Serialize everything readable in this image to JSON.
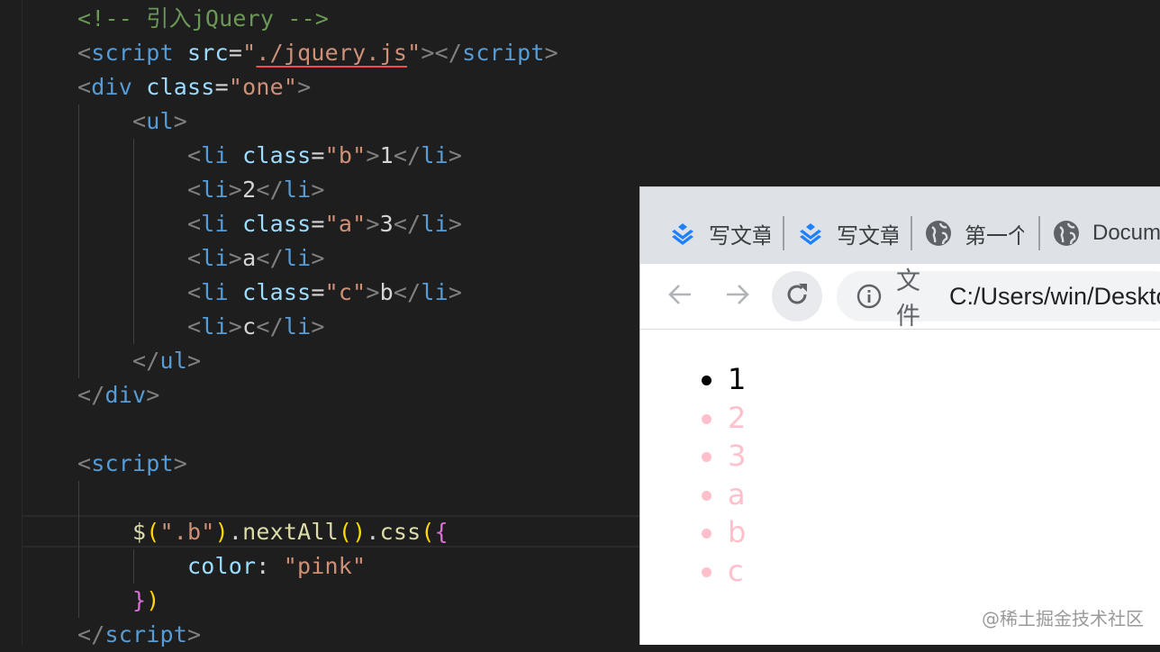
{
  "editor": {
    "lines": [
      [
        [
          "tk-cmt",
          "<!-- 引入jQuery -->"
        ]
      ],
      [
        [
          "tk-punct",
          "<"
        ],
        [
          "tk-tag",
          "script"
        ],
        [
          "tk-text",
          " "
        ],
        [
          "tk-attr",
          "src"
        ],
        [
          "tk-text",
          "="
        ],
        [
          "tk-str",
          "\""
        ],
        [
          "tk-str src-link",
          "./jquery.js"
        ],
        [
          "tk-str",
          "\""
        ],
        [
          "tk-punct",
          "></"
        ],
        [
          "tk-tag",
          "script"
        ],
        [
          "tk-punct",
          ">"
        ]
      ],
      [
        [
          "tk-punct",
          "<"
        ],
        [
          "tk-tag",
          "div"
        ],
        [
          "tk-text",
          " "
        ],
        [
          "tk-attr",
          "class"
        ],
        [
          "tk-text",
          "="
        ],
        [
          "tk-str",
          "\"one\""
        ],
        [
          "tk-punct",
          ">"
        ]
      ],
      [
        [
          "tk-text",
          "    "
        ],
        [
          "tk-punct",
          "<"
        ],
        [
          "tk-tag",
          "ul"
        ],
        [
          "tk-punct",
          ">"
        ]
      ],
      [
        [
          "tk-text",
          "        "
        ],
        [
          "tk-punct",
          "<"
        ],
        [
          "tk-tag",
          "li"
        ],
        [
          "tk-text",
          " "
        ],
        [
          "tk-attr",
          "class"
        ],
        [
          "tk-text",
          "="
        ],
        [
          "tk-str",
          "\"b\""
        ],
        [
          "tk-punct",
          ">"
        ],
        [
          "tk-text",
          "1"
        ],
        [
          "tk-punct",
          "</"
        ],
        [
          "tk-tag",
          "li"
        ],
        [
          "tk-punct",
          ">"
        ]
      ],
      [
        [
          "tk-text",
          "        "
        ],
        [
          "tk-punct",
          "<"
        ],
        [
          "tk-tag",
          "li"
        ],
        [
          "tk-punct",
          ">"
        ],
        [
          "tk-text",
          "2"
        ],
        [
          "tk-punct",
          "</"
        ],
        [
          "tk-tag",
          "li"
        ],
        [
          "tk-punct",
          ">"
        ]
      ],
      [
        [
          "tk-text",
          "        "
        ],
        [
          "tk-punct",
          "<"
        ],
        [
          "tk-tag",
          "li"
        ],
        [
          "tk-text",
          " "
        ],
        [
          "tk-attr",
          "class"
        ],
        [
          "tk-text",
          "="
        ],
        [
          "tk-str",
          "\"a\""
        ],
        [
          "tk-punct",
          ">"
        ],
        [
          "tk-text",
          "3"
        ],
        [
          "tk-punct",
          "</"
        ],
        [
          "tk-tag",
          "li"
        ],
        [
          "tk-punct",
          ">"
        ]
      ],
      [
        [
          "tk-text",
          "        "
        ],
        [
          "tk-punct",
          "<"
        ],
        [
          "tk-tag",
          "li"
        ],
        [
          "tk-punct",
          ">"
        ],
        [
          "tk-text",
          "a"
        ],
        [
          "tk-punct",
          "</"
        ],
        [
          "tk-tag",
          "li"
        ],
        [
          "tk-punct",
          ">"
        ]
      ],
      [
        [
          "tk-text",
          "        "
        ],
        [
          "tk-punct",
          "<"
        ],
        [
          "tk-tag",
          "li"
        ],
        [
          "tk-text",
          " "
        ],
        [
          "tk-attr",
          "class"
        ],
        [
          "tk-text",
          "="
        ],
        [
          "tk-str",
          "\"c\""
        ],
        [
          "tk-punct",
          ">"
        ],
        [
          "tk-text",
          "b"
        ],
        [
          "tk-punct",
          "</"
        ],
        [
          "tk-tag",
          "li"
        ],
        [
          "tk-punct",
          ">"
        ]
      ],
      [
        [
          "tk-text",
          "        "
        ],
        [
          "tk-punct",
          "<"
        ],
        [
          "tk-tag",
          "li"
        ],
        [
          "tk-punct",
          ">"
        ],
        [
          "tk-text",
          "c"
        ],
        [
          "tk-punct",
          "</"
        ],
        [
          "tk-tag",
          "li"
        ],
        [
          "tk-punct",
          ">"
        ]
      ],
      [
        [
          "tk-text",
          "    "
        ],
        [
          "tk-punct",
          "</"
        ],
        [
          "tk-tag",
          "ul"
        ],
        [
          "tk-punct",
          ">"
        ]
      ],
      [
        [
          "tk-punct",
          "</"
        ],
        [
          "tk-tag",
          "div"
        ],
        [
          "tk-punct",
          ">"
        ]
      ],
      [],
      [
        [
          "tk-punct",
          "<"
        ],
        [
          "tk-tag",
          "script"
        ],
        [
          "tk-punct",
          ">"
        ]
      ],
      [],
      [
        [
          "tk-text",
          "    "
        ],
        [
          "tk-fn",
          "$"
        ],
        [
          "tk-br1",
          "("
        ],
        [
          "tk-str",
          "\".b\""
        ],
        [
          "tk-br1",
          ")"
        ],
        [
          "tk-text",
          "."
        ],
        [
          "tk-fn",
          "nextAll"
        ],
        [
          "tk-br1",
          "()"
        ],
        [
          "tk-text",
          "."
        ],
        [
          "tk-fn",
          "css"
        ],
        [
          "tk-br1",
          "("
        ],
        [
          "tk-br2",
          "{"
        ]
      ],
      [
        [
          "tk-text",
          "        "
        ],
        [
          "tk-attr",
          "color"
        ],
        [
          "tk-text",
          ": "
        ],
        [
          "tk-str",
          "\"pink\""
        ]
      ],
      [
        [
          "tk-text",
          "    "
        ],
        [
          "tk-br2",
          "}"
        ],
        [
          "tk-br1",
          ")"
        ]
      ],
      [
        [
          "tk-punct",
          "</"
        ],
        [
          "tk-tag",
          "script"
        ],
        [
          "tk-punct",
          ">"
        ]
      ]
    ]
  },
  "browser": {
    "tabs": [
      {
        "label": "写文章",
        "icon": "juejin-logo-icon"
      },
      {
        "label": "写文章",
        "icon": "juejin-logo-icon"
      },
      {
        "label": "第一个",
        "icon": "globe-icon"
      },
      {
        "label": "Document",
        "icon": "globe-icon"
      }
    ],
    "nav": {
      "back": "arrow-left-icon",
      "forward": "arrow-right-icon",
      "reload": "reload-icon"
    },
    "omnibox": {
      "scheme": "文件",
      "url": "C:/Users/win/Desktop"
    },
    "list_items": [
      {
        "text": "1",
        "color": "#000000"
      },
      {
        "text": "2",
        "color": "#ffc0cb"
      },
      {
        "text": "3",
        "color": "#ffc0cb"
      },
      {
        "text": "a",
        "color": "#ffc0cb"
      },
      {
        "text": "b",
        "color": "#ffc0cb"
      },
      {
        "text": "c",
        "color": "#ffc0cb"
      }
    ]
  },
  "watermark": "@稀土掘金技术社区"
}
